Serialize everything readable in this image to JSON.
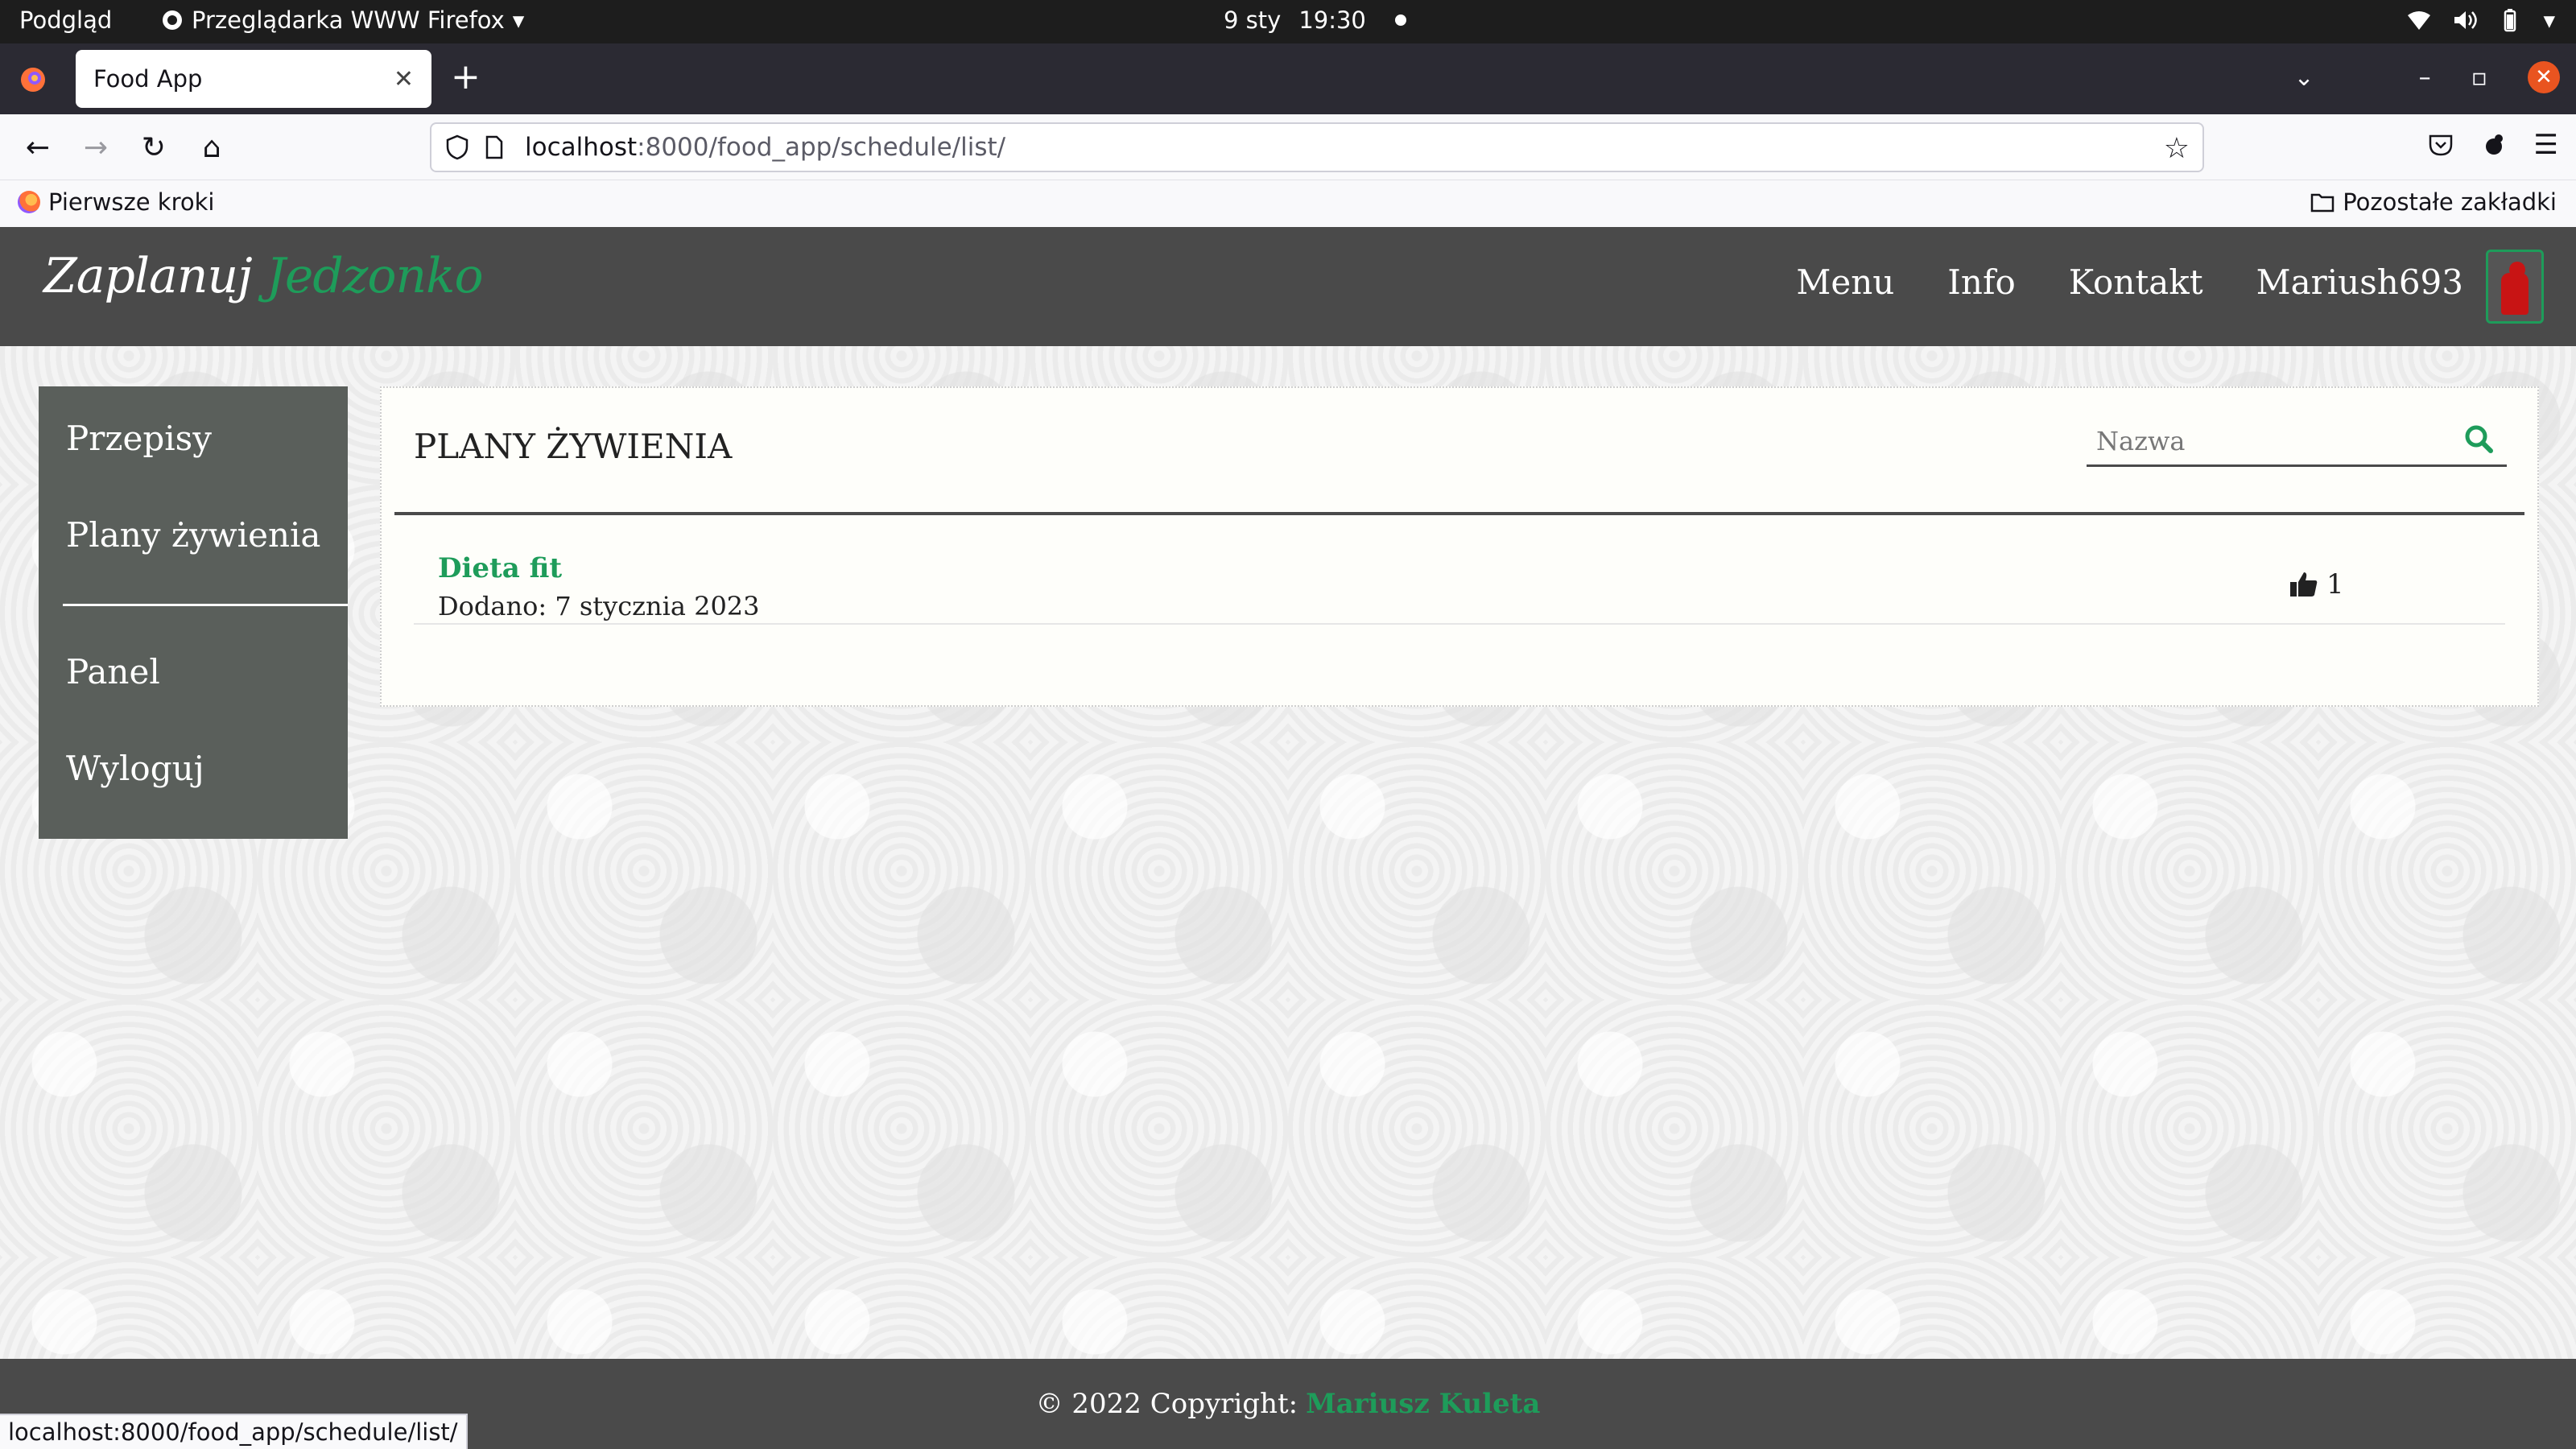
{
  "os": {
    "activities": "Podgląd",
    "app_name": "Przeglądarka WWW Firefox",
    "date": "9 sty",
    "time": "19:30"
  },
  "browser": {
    "tab_title": "Food App",
    "url_host": "localhost",
    "url_path": ":8000/food_app/schedule/list/",
    "bookmark_first": "Pierwsze kroki",
    "bookmark_other": "Pozostałe zakładki",
    "status_url": "localhost:8000/food_app/schedule/list/"
  },
  "site": {
    "brand_part1": "Zaplanuj",
    "brand_part2": "Jedzonko",
    "menu": [
      "Menu",
      "Info",
      "Kontakt",
      "Mariush693"
    ],
    "sidebar": {
      "items": [
        "Przepisy",
        "Plany żywienia",
        "Panel",
        "Wyloguj"
      ]
    },
    "main": {
      "heading": "PLANY ŻYWIENIA",
      "search_placeholder": "Nazwa",
      "plans": [
        {
          "name": "Dieta fit",
          "added": "Dodano: 7 stycznia 2023",
          "likes": "1"
        }
      ]
    },
    "footer": {
      "copyright": "© 2022 Copyright:",
      "author": "Mariusz Kuleta"
    }
  },
  "colors": {
    "accent_green": "#1e9c5a",
    "header_bg": "#4a4a4a",
    "sidebar_bg": "#5a5f5b"
  }
}
